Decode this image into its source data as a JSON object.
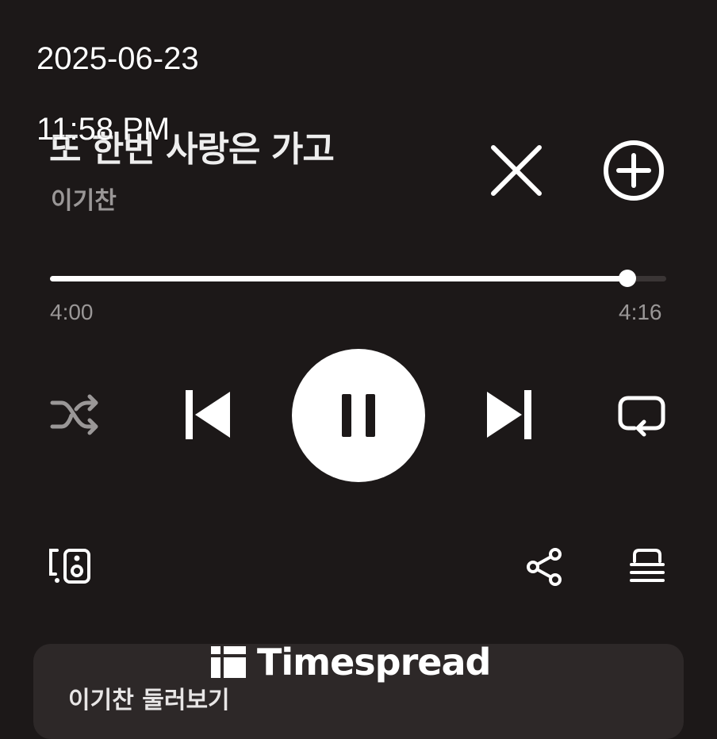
{
  "overlay": {
    "date": "2025-06-23",
    "time": "11:58 PM"
  },
  "track": {
    "title": "또 한번 사랑은 가고",
    "artist": "이기찬"
  },
  "progress": {
    "elapsed": "4:00",
    "duration": "4:16",
    "fraction": 0.9375
  },
  "icons": {
    "close": "close-icon",
    "add": "add-circle-icon",
    "shuffle": "shuffle-icon",
    "previous": "skip-previous-icon",
    "pause": "pause-icon",
    "next": "skip-next-icon",
    "repeat": "repeat-icon",
    "device": "speaker-device-icon",
    "share": "share-icon",
    "queue": "queue-list-icon"
  },
  "bottom_card": {
    "title": "이기찬 둘러보기"
  },
  "watermark": {
    "text": "Timespread"
  },
  "colors": {
    "background": "#1c1818",
    "primary": "#ffffff",
    "secondary": "#9a9797",
    "card": "#2d2828"
  }
}
